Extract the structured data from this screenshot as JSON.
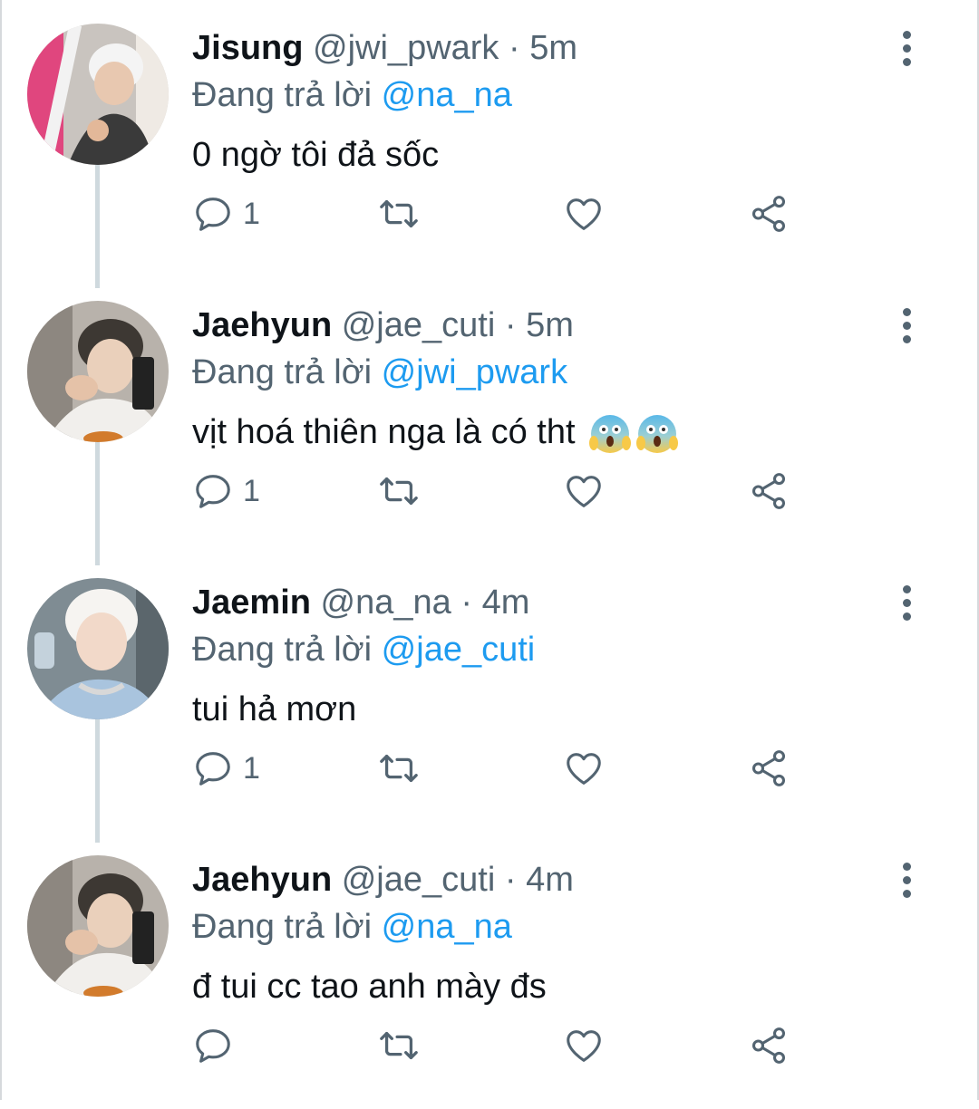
{
  "reply_prefix": "Đang trả lời",
  "separator": "·",
  "colors": {
    "name": "#0f1419",
    "secondary": "#536471",
    "mention": "#1d9bf0",
    "thread_line": "#cfd9de"
  },
  "tweets": [
    {
      "name": "Jisung",
      "handle": "@jwi_pwark",
      "time": "5m",
      "reply_to": "@na_na",
      "text": "0 ngờ tôi đả sốc",
      "reply_count": "1",
      "emoji": [],
      "avatar_icon": "avatar-jisung-photo"
    },
    {
      "name": "Jaehyun",
      "handle": "@jae_cuti",
      "time": "5m",
      "reply_to": "@jwi_pwark",
      "text": "vịt hoá thiên nga là có tht",
      "reply_count": "1",
      "emoji": [
        "face-screaming-in-fear-icon",
        "face-screaming-in-fear-icon"
      ],
      "avatar_icon": "avatar-jaehyun-photo"
    },
    {
      "name": "Jaemin",
      "handle": "@na_na",
      "time": "4m",
      "reply_to": "@jae_cuti",
      "text": "tui hả mơn",
      "reply_count": "1",
      "emoji": [],
      "avatar_icon": "avatar-jaemin-photo"
    },
    {
      "name": "Jaehyun",
      "handle": "@jae_cuti",
      "time": "4m",
      "reply_to": "@na_na",
      "text": "đ tui cc tao anh mày đs",
      "reply_count": "",
      "emoji": [],
      "avatar_icon": "avatar-jaehyun-photo"
    }
  ]
}
